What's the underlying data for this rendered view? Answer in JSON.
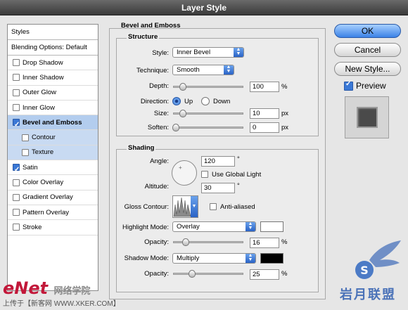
{
  "window": {
    "title": "Layer Style"
  },
  "sidebar": {
    "header": "Styles",
    "blending": "Blending Options: Default",
    "items": [
      {
        "label": "Drop Shadow",
        "checked": false
      },
      {
        "label": "Inner Shadow",
        "checked": false
      },
      {
        "label": "Outer Glow",
        "checked": false
      },
      {
        "label": "Inner Glow",
        "checked": false
      },
      {
        "label": "Bevel and Emboss",
        "checked": true
      },
      {
        "label": "Contour",
        "checked": false
      },
      {
        "label": "Texture",
        "checked": false
      },
      {
        "label": "Satin",
        "checked": true
      },
      {
        "label": "Color Overlay",
        "checked": false
      },
      {
        "label": "Gradient Overlay",
        "checked": false
      },
      {
        "label": "Pattern Overlay",
        "checked": false
      },
      {
        "label": "Stroke",
        "checked": false
      }
    ]
  },
  "bevel": {
    "group_title": "Bevel and Emboss",
    "structure_title": "Structure",
    "style_label": "Style:",
    "style_value": "Inner Bevel",
    "technique_label": "Technique:",
    "technique_value": "Smooth",
    "depth_label": "Depth:",
    "depth_value": "100",
    "depth_unit": "%",
    "direction_label": "Direction:",
    "up_label": "Up",
    "down_label": "Down",
    "size_label": "Size:",
    "size_value": "10",
    "size_unit": "px",
    "soften_label": "Soften:",
    "soften_value": "0",
    "soften_unit": "px"
  },
  "shading": {
    "title": "Shading",
    "angle_label": "Angle:",
    "angle_value": "120",
    "angle_unit": "°",
    "global_light_label": "Use Global Light",
    "altitude_label": "Altitude:",
    "altitude_value": "30",
    "altitude_unit": "°",
    "gloss_label": "Gloss Contour:",
    "anti_aliased_label": "Anti-aliased",
    "highlight_label": "Highlight Mode:",
    "highlight_value": "Overlay",
    "highlight_opacity_label": "Opacity:",
    "highlight_opacity_value": "16",
    "highlight_opacity_unit": "%",
    "shadow_label": "Shadow Mode:",
    "shadow_value": "Multiply",
    "shadow_opacity_label": "Opacity:",
    "shadow_opacity_value": "25",
    "shadow_opacity_unit": "%"
  },
  "buttons": {
    "ok": "OK",
    "cancel": "Cancel",
    "new_style": "New Style...",
    "preview": "Preview"
  },
  "watermark": {
    "left": "eNet",
    "cn": "网络学院",
    "footer": "上传于【新客网 WWW.XKER.COM】",
    "right": "岩月联盟"
  },
  "colors": {
    "highlight": "#ffffff",
    "shadow": "#000000",
    "accent": "#3b82e6",
    "preview": "#4a4a4a"
  }
}
